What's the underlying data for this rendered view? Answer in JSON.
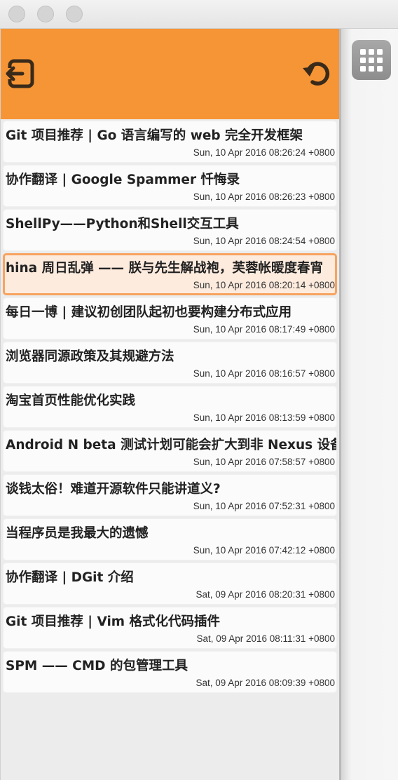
{
  "window": {
    "traffic_lights": [
      "close",
      "minimize",
      "zoom"
    ]
  },
  "header": {
    "background_color": "#f69535",
    "left_icon": "exit-icon",
    "right_icon": "refresh-icon"
  },
  "sidebar": {
    "button_icon": "grid-icon"
  },
  "articles": [
    {
      "title": "Git 项目推荐 | Go 语言编写的 web 完全开发框架",
      "date": "Sun, 10 Apr 2016 08:26:24 +0800"
    },
    {
      "title": "协作翻译 | Google Spammer 忏悔录",
      "date": "Sun, 10 Apr 2016 08:26:23 +0800"
    },
    {
      "title": "ShellPy——Python和Shell交互工具",
      "date": "Sun, 10 Apr 2016 08:24:54 +0800"
    },
    {
      "title": "hina 周日乱弹 —— 朕与先生解战袍，芙蓉帐暖度春宵",
      "date": "Sun, 10 Apr 2016 08:20:14 +0800",
      "selected": true
    },
    {
      "title": "每日一博 | 建议初创团队起初也要构建分布式应用",
      "date": "Sun, 10 Apr 2016 08:17:49 +0800"
    },
    {
      "title": "浏览器同源政策及其规避方法",
      "date": "Sun, 10 Apr 2016 08:16:57 +0800"
    },
    {
      "title": "淘宝首页性能优化实践",
      "date": "Sun, 10 Apr 2016 08:13:59 +0800"
    },
    {
      "title": "Android N beta 测试计划可能会扩大到非 Nexus 设备",
      "date": "Sun, 10 Apr 2016 07:58:57 +0800"
    },
    {
      "title": "谈钱太俗！难道开源软件只能讲道义?",
      "date": "Sun, 10 Apr 2016 07:52:31 +0800"
    },
    {
      "title": "当程序员是我最大的遗憾",
      "date": "Sun, 10 Apr 2016 07:42:12 +0800"
    },
    {
      "title": "协作翻译 | DGit 介绍",
      "date": "Sat, 09 Apr 2016 08:20:31 +0800"
    },
    {
      "title": "Git 项目推荐 | Vim 格式化代码插件",
      "date": "Sat, 09 Apr 2016 08:11:31 +0800"
    },
    {
      "title": "SPM —— CMD 的包管理工具",
      "date": "Sat, 09 Apr 2016 08:09:39 +0800"
    }
  ]
}
